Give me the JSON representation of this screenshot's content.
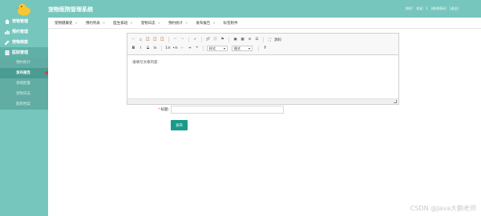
{
  "app": {
    "title": "宠物医院管理系统"
  },
  "header": {
    "user_links": [
      "你好!",
      "欢迎：1",
      "[修改密码]",
      "[退出]"
    ]
  },
  "sidebar": {
    "items": [
      {
        "label": "宠物管理",
        "icon": "home-icon"
      },
      {
        "label": "预约管理",
        "icon": "chart-icon"
      },
      {
        "label": "宠物档案",
        "icon": "edit-icon"
      },
      {
        "label": "医院管理",
        "icon": "document-icon",
        "active": true
      }
    ],
    "subitems": [
      {
        "label": "预约统计"
      },
      {
        "label": "发布报告",
        "current": true
      },
      {
        "label": "领域配置"
      },
      {
        "label": "宠物日志"
      },
      {
        "label": "医院档案"
      }
    ]
  },
  "tabs": [
    {
      "label": "宠物健康史",
      "close": "×"
    },
    {
      "label": "预约列表",
      "close": "×"
    },
    {
      "label": "医生排班",
      "close": "×"
    },
    {
      "label": "宠物日志",
      "close": "×"
    },
    {
      "label": "预约统计",
      "close": "×"
    },
    {
      "label": "发布报告",
      "close": "×",
      "active": true
    },
    {
      "label": "标签附件",
      "close": ""
    }
  ],
  "editor": {
    "toolbar_row1": [
      "✂",
      "⧉",
      "📋",
      "📋",
      "📋",
      "↶",
      "↷",
      "✓",
      "🔗",
      "⛓",
      "⚑",
      "▣",
      "▦",
      "≡",
      "Ω",
      "⛶",
      "源码"
    ],
    "toolbar_row2": [
      "B",
      "I",
      "S",
      "Ix",
      "1≡",
      "•≡",
      "⇤",
      "⇥",
      "❝"
    ],
    "style_select": "样式",
    "format_select": "格式",
    "help": "?",
    "placeholder": "请填写文章内容"
  },
  "form": {
    "title_label": "标题:",
    "required_mark": "*",
    "title_value": "",
    "submit_label": "发布"
  },
  "watermark": "CSDN @Java大鹅老师"
}
